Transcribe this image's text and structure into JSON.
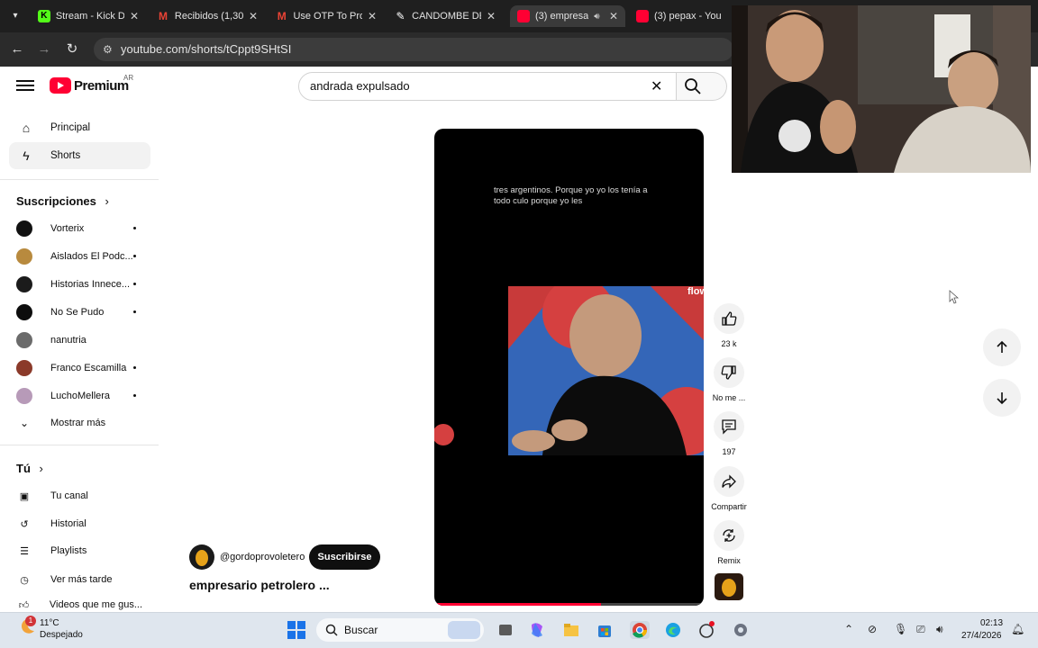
{
  "browser": {
    "tabs": [
      {
        "title": "Stream - Kick D",
        "favicon": "kick-icon",
        "color": "#53fc18"
      },
      {
        "title": "Recibidos (1,30",
        "favicon": "gmail-icon",
        "color": "#ea4335"
      },
      {
        "title": "Use OTP To Pro",
        "favicon": "gmail-icon",
        "color": "#ea4335"
      },
      {
        "title": "CANDOMBE DE",
        "favicon": "drawing-icon",
        "color": "#ffffff"
      },
      {
        "title": "(3) empresa",
        "favicon": "youtube-icon",
        "color": "#ff0033"
      },
      {
        "title": "(3) pepax - You",
        "favicon": "youtube-icon",
        "color": "#ff0033"
      }
    ],
    "url": "youtube.com/shorts/tCppt9SHtSI"
  },
  "header": {
    "brand": "Premium",
    "region": "AR",
    "search_value": "andrada expulsado"
  },
  "sidebar": {
    "main": [
      {
        "label": "Principal",
        "icon": "home-icon"
      },
      {
        "label": "Shorts",
        "icon": "shorts-icon"
      }
    ],
    "subs_title": "Suscripciones",
    "subs": [
      {
        "label": "Vorterix",
        "color": "#111111",
        "dot": true
      },
      {
        "label": "Aislados El Podc...",
        "color": "#b88a3e",
        "dot": true
      },
      {
        "label": "Historias Innece...",
        "color": "#1b1b1b",
        "dot": true
      },
      {
        "label": "No Se Pudo",
        "color": "#0d0d0d",
        "dot": true
      },
      {
        "label": "nanutria",
        "color": "#6b6b6b",
        "dot": false
      },
      {
        "label": "Franco Escamilla",
        "color": "#8b3a2a",
        "dot": true
      },
      {
        "label": "LuchoMellera",
        "color": "#b79ab8",
        "dot": true
      }
    ],
    "show_more": "Mostrar más",
    "you_title": "Tú",
    "you": [
      {
        "label": "Tu canal",
        "icon": "channel-icon"
      },
      {
        "label": "Historial",
        "icon": "history-icon"
      },
      {
        "label": "Playlists",
        "icon": "playlists-icon"
      },
      {
        "label": "Ver más tarde",
        "icon": "watch-later-icon"
      },
      {
        "label": "Videos que me gus...",
        "icon": "liked-icon"
      }
    ]
  },
  "short": {
    "caption": "tres argentinos. Porque yo yo los tenía a todo culo porque yo les",
    "watermark": "flow",
    "progress": 0.62,
    "channel": "@gordoprovoletero",
    "subscribe": "Suscribirse",
    "title": "empresario petrolero ..."
  },
  "actions": {
    "like_count": "23 k",
    "dislike": "No me ...",
    "comments": "197",
    "share": "Compartir",
    "remix": "Remix"
  },
  "taskbar": {
    "temp": "11°C",
    "weather": "Despejado",
    "weather_badge": "1",
    "search": "Buscar",
    "time": "02:13",
    "date": "27/4/2026"
  }
}
